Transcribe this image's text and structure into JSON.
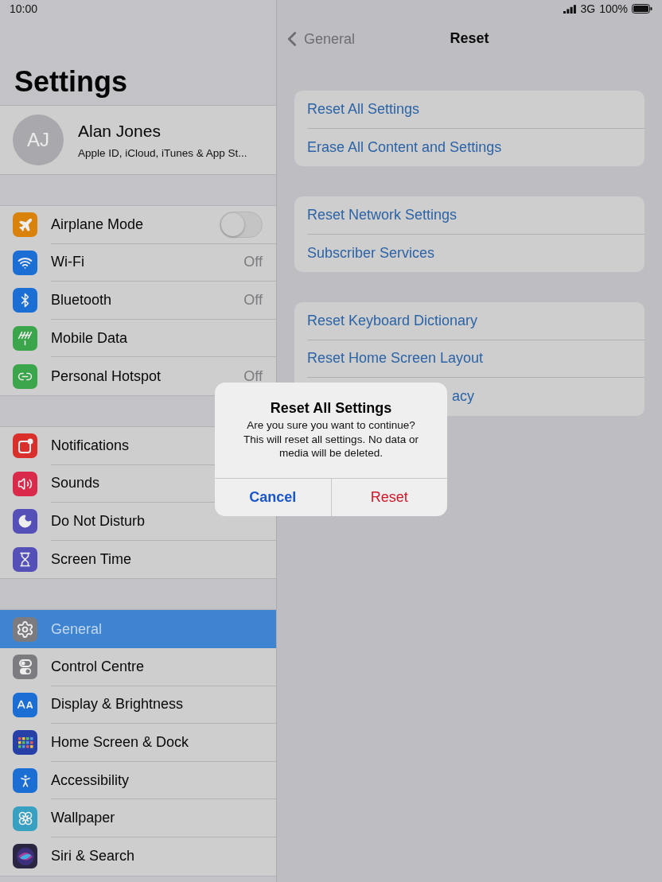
{
  "status_bar": {
    "time": "10:00",
    "network": "3G",
    "battery": "100%"
  },
  "sidebar": {
    "title": "Settings",
    "profile": {
      "initials": "AJ",
      "name": "Alan Jones",
      "subtitle": "Apple ID, iCloud, iTunes & App St..."
    },
    "groups": [
      [
        {
          "label": "Airplane Mode",
          "kind": "toggle",
          "on": false,
          "color": "#d9820b",
          "selected": false
        },
        {
          "label": "Wi-Fi",
          "kind": "value",
          "value": "Off",
          "color": "#1b6fd4",
          "selected": false
        },
        {
          "label": "Bluetooth",
          "kind": "value",
          "value": "Off",
          "color": "#1b6fd4",
          "selected": false
        },
        {
          "label": "Mobile Data",
          "kind": "plain",
          "color": "#3aa54a",
          "selected": false
        },
        {
          "label": "Personal Hotspot",
          "kind": "value",
          "value": "Off",
          "color": "#3aa54a",
          "selected": false
        }
      ],
      [
        {
          "label": "Notifications",
          "kind": "plain",
          "color": "#d9302c",
          "selected": false
        },
        {
          "label": "Sounds",
          "kind": "plain",
          "color": "#d92a4c",
          "selected": false
        },
        {
          "label": "Do Not Disturb",
          "kind": "plain",
          "color": "#5450b8",
          "selected": false
        },
        {
          "label": "Screen Time",
          "kind": "plain",
          "color": "#5450b8",
          "selected": false
        }
      ],
      [
        {
          "label": "General",
          "kind": "plain",
          "color": "#7c7c80",
          "selected": true
        },
        {
          "label": "Control Centre",
          "kind": "plain",
          "color": "#7c7c80",
          "selected": false
        },
        {
          "label": "Display & Brightness",
          "kind": "plain",
          "color": "#1b6fd4",
          "selected": false
        },
        {
          "label": "Home Screen & Dock",
          "kind": "plain",
          "color": "#2740a8",
          "selected": false
        },
        {
          "label": "Accessibility",
          "kind": "plain",
          "color": "#1b6fd4",
          "selected": false
        },
        {
          "label": "Wallpaper",
          "kind": "plain",
          "color": "#38a0c0",
          "selected": false
        },
        {
          "label": "Siri & Search",
          "kind": "plain",
          "color": "#2a2540",
          "selected": false
        }
      ]
    ]
  },
  "detail": {
    "back": "General",
    "title": "Reset",
    "groups": [
      [
        {
          "label": "Reset All Settings",
          "kind": "full"
        },
        {
          "label": "Erase All Content and Settings",
          "kind": "full"
        }
      ],
      [
        {
          "label": "Reset Network Settings",
          "kind": "full"
        },
        {
          "label": "Subscriber Services",
          "kind": "full"
        }
      ],
      [
        {
          "label": "Reset Keyboard Dictionary",
          "kind": "full"
        },
        {
          "label": "Reset Home Screen Layout",
          "kind": "full"
        },
        {
          "label": "acy",
          "kind": "covered"
        }
      ]
    ]
  },
  "alert": {
    "title": "Reset All Settings",
    "message": "Are you sure you want to continue? This will reset all settings. No data or media will be deleted.",
    "buttons": [
      {
        "label": "Cancel",
        "kind": "cancel"
      },
      {
        "label": "Reset",
        "kind": "destructive"
      }
    ]
  }
}
